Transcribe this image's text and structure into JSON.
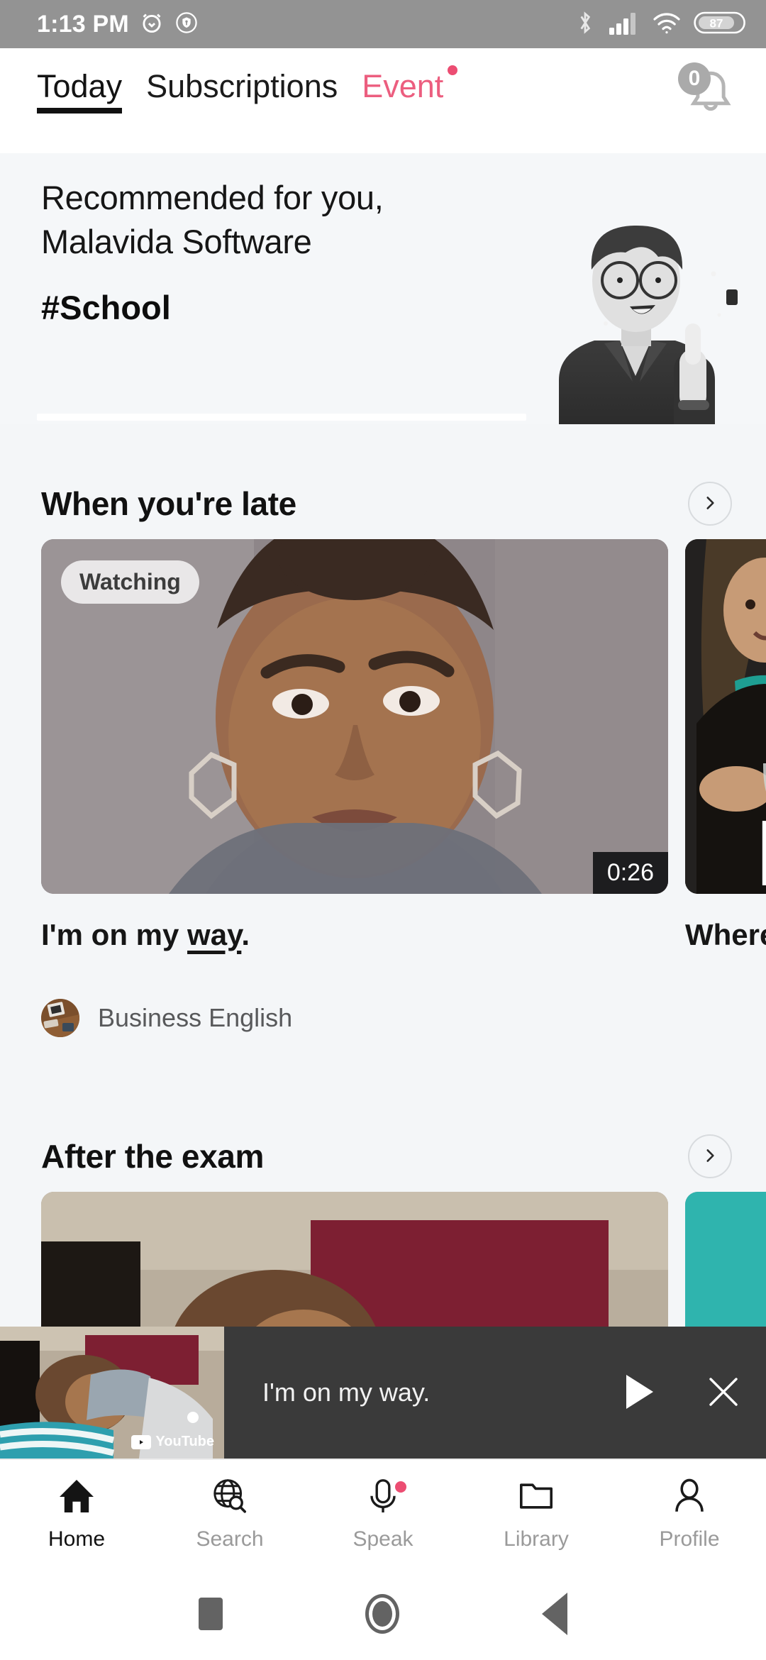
{
  "statusbar": {
    "time": "1:13 PM",
    "alarm_icon": "alarm-icon",
    "vpn_icon": "shield-key-icon",
    "bluetooth_icon": "bluetooth-icon",
    "signal_icon": "cellular-signal-icon",
    "wifi_icon": "wifi-icon",
    "battery_level": "87"
  },
  "topbar": {
    "tabs": [
      {
        "label": "Today",
        "active": true
      },
      {
        "label": "Subscriptions",
        "active": false
      },
      {
        "label": "Event",
        "active": false,
        "accent": true,
        "has_dot": true
      }
    ],
    "notifications": {
      "icon": "bell-icon",
      "count": "0"
    }
  },
  "banner": {
    "line1": "Recommended for you,",
    "line2": "Malavida Software",
    "hashtag": "#School",
    "illustration": "teacher-character-illustration"
  },
  "sections": [
    {
      "title": "When you're late",
      "chevron": "chevron-right-icon",
      "cards": [
        {
          "badge": "Watching",
          "duration": "0:26",
          "title_prefix": "I'm on my ",
          "title_underlined": "way",
          "title_suffix": ".",
          "channel": "Business English",
          "thumbnail": "woman-frowning-thumbnail",
          "avatar": "business-english-avatar"
        },
        {
          "title": "Where",
          "thumbnail": "woman-wine-glass-thumbnail",
          "overlay_text": "L"
        }
      ]
    },
    {
      "title": "After the exam",
      "chevron": "chevron-right-icon",
      "cards": [
        {
          "thumbnail": "person-lying-down-thumbnail"
        },
        {
          "thumbnail": "teal-card-thumbnail"
        }
      ]
    }
  ],
  "miniplayer": {
    "title": "I'm on my way.",
    "thumbnail": "miniplayer-thumbnail",
    "source_label": "YouTube",
    "play_icon": "play-icon",
    "close_icon": "close-icon"
  },
  "bottomnav": {
    "items": [
      {
        "label": "Home",
        "icon": "home-icon",
        "active": true,
        "dot": false
      },
      {
        "label": "Search",
        "icon": "globe-search-icon",
        "active": false,
        "dot": false
      },
      {
        "label": "Speak",
        "icon": "microphone-icon",
        "active": false,
        "dot": true
      },
      {
        "label": "Library",
        "icon": "folder-icon",
        "active": false,
        "dot": false
      },
      {
        "label": "Profile",
        "icon": "person-icon",
        "active": false,
        "dot": false
      }
    ]
  },
  "androidnav": {
    "recents": "recents-square-icon",
    "home": "home-circle-icon",
    "back": "back-triangle-icon"
  },
  "colors": {
    "accent_pink": "#ec5e7f",
    "background": "#f4f6f8",
    "statusbar": "#939393",
    "miniplayer": "#3a3a3a"
  }
}
